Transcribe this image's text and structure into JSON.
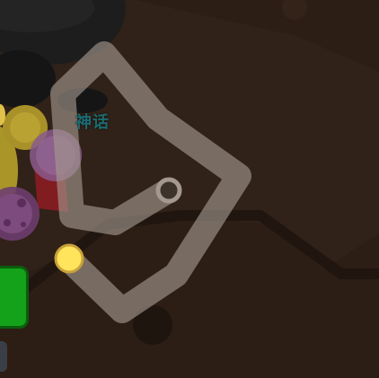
{
  "world": {
    "colors": {
      "ground": "#2d1f15",
      "ground_dark": "#231710",
      "ridge": "#1f140e",
      "path": "#8f857d",
      "player": "#ffe45c",
      "player_ring": "#d8b43c",
      "enemy_dark": "#1c1c1c",
      "cell_yellow": "#b6a02a",
      "cell_purple": "#7d4b7e",
      "cell_red": "#8f1e24",
      "hud_green": "#14a21a"
    }
  },
  "labels": {
    "name": "神话"
  },
  "icons": {
    "path_start": "hollow-circle-icon",
    "player": "player-dot-icon"
  }
}
